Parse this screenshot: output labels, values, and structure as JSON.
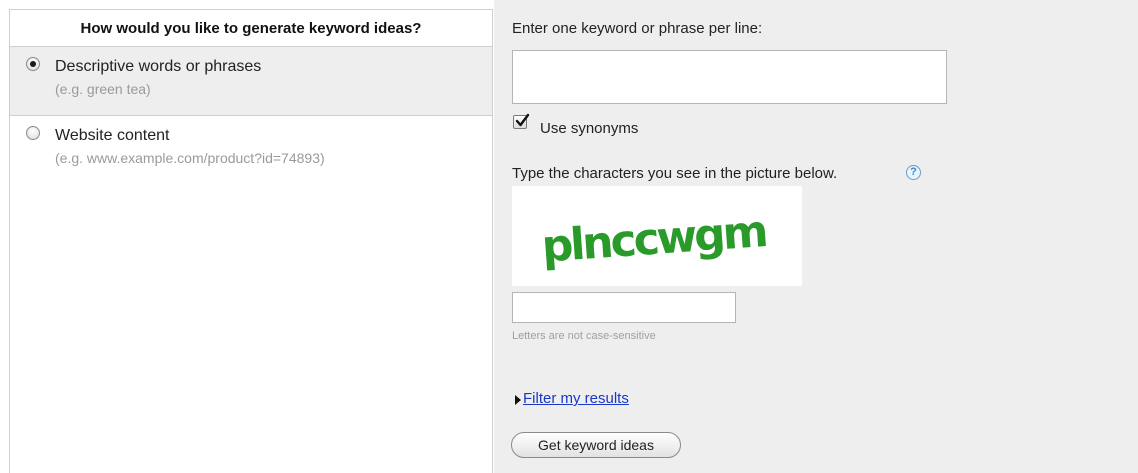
{
  "left_panel": {
    "heading": "How would you like to generate keyword ideas?",
    "options": [
      {
        "label": "Descriptive words or phrases",
        "example": "(e.g. green tea)",
        "selected": true
      },
      {
        "label": "Website content",
        "example": "(e.g. www.example.com/product?id=74893)",
        "selected": false
      }
    ]
  },
  "right_panel": {
    "keyword_prompt": "Enter one keyword or phrase per line:",
    "keyword_value": "",
    "use_synonyms_label": "Use synonyms",
    "use_synonyms_checked": true,
    "captcha_prompt": "Type the characters you see in the picture below.",
    "help_icon": "question-mark-icon",
    "captcha_text": "plnccwgm",
    "captcha_color": "#2a9a2a",
    "captcha_input_value": "",
    "case_note": "Letters are not case-sensitive",
    "filter_link": "Filter my results",
    "submit_label": "Get keyword ideas"
  },
  "colors": {
    "panel_bg": "#eeeeee",
    "link": "#1a37c9",
    "muted_text": "#9a9a9a"
  }
}
